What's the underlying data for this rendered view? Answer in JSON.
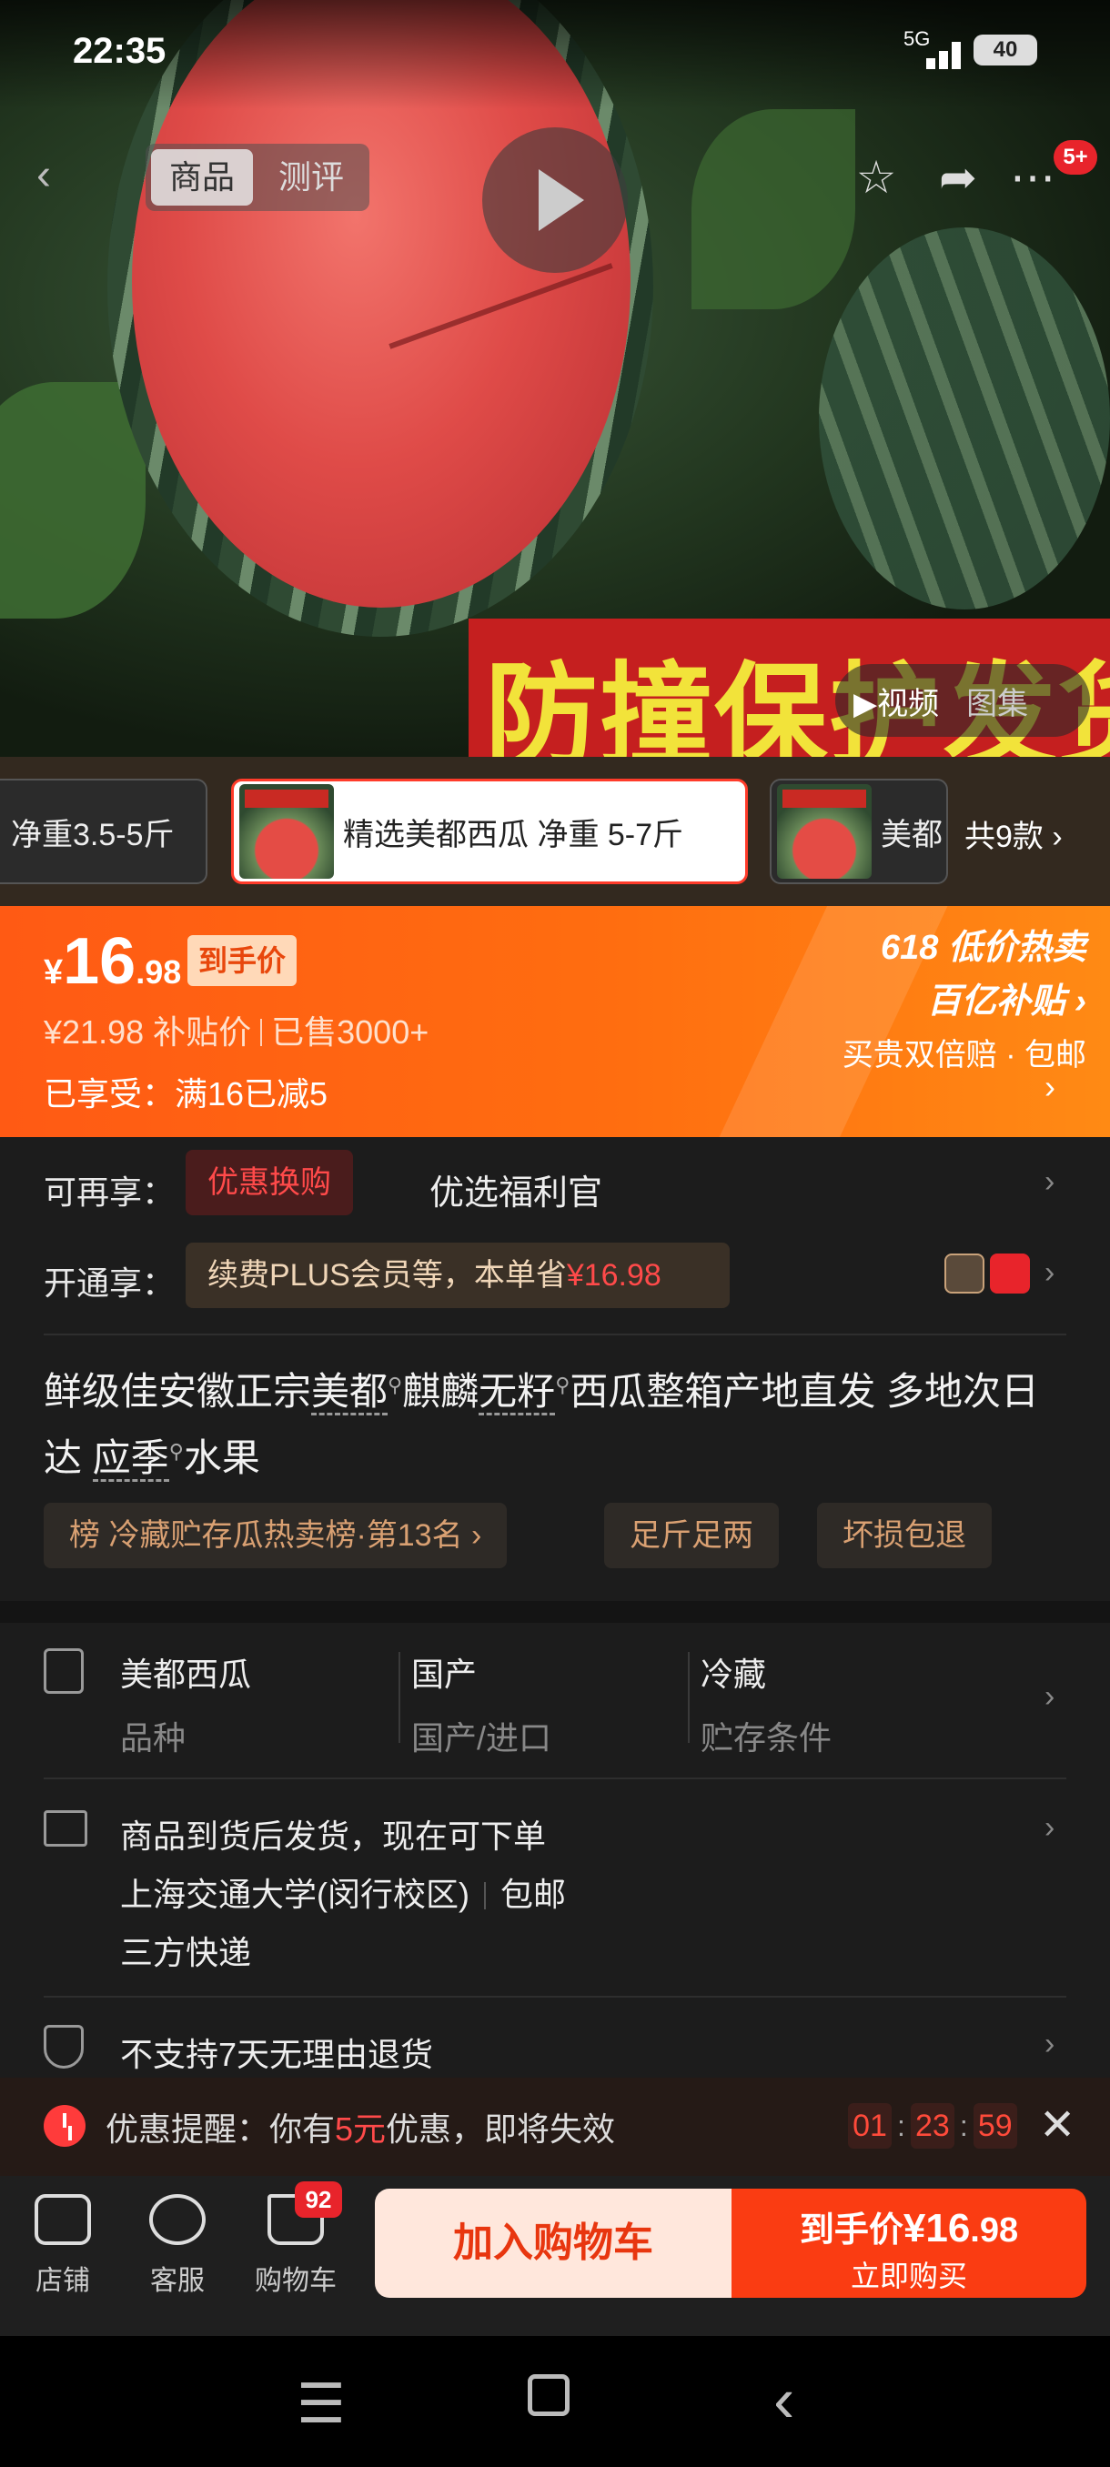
{
  "status_bar": {
    "time": "22:35",
    "network": "5G",
    "battery": "40"
  },
  "top_nav": {
    "tabs": [
      {
        "label": "商品",
        "active": true
      },
      {
        "label": "测评",
        "active": false
      }
    ],
    "badge": "5+",
    "icons": [
      "back-icon",
      "star-icon",
      "share-icon",
      "more-icon",
      "play-icon"
    ]
  },
  "hero": {
    "banner_text": "防撞保护发货",
    "media_tabs": [
      {
        "label": "▶视频",
        "active": true
      },
      {
        "label": "图集",
        "active": false
      }
    ]
  },
  "variants": {
    "items": [
      {
        "label": "净重3.5-5斤",
        "selected": false
      },
      {
        "label": "精选美都西瓜 净重 5-7斤",
        "selected": true
      },
      {
        "label": "美都",
        "selected": false
      }
    ],
    "count_label": "共9款 ›"
  },
  "price": {
    "currency": "¥",
    "integer": "16",
    "decimal": ".98",
    "tag": "到手价",
    "original": "¥21.98",
    "subsidy_label": "补贴价",
    "sold": "已售3000+",
    "discount": "已享受：满16已减5",
    "promo_line1": "618 低价热卖",
    "promo_line2": "百亿补贴 ›",
    "promo_line3": "买贵双倍赔 · 包邮",
    "accent_color": "#ff5a14"
  },
  "coupons": {
    "row1_label": "可再享：",
    "row1_pill": "优惠换购",
    "row1_text": "优选福利官",
    "row2_label": "开通享：",
    "row2_pill_text": "续费PLUS会员等，本单省",
    "row2_pill_amount": "¥16.98"
  },
  "product_title": {
    "part1": "鲜级佳安徽正宗",
    "kw1": "美都",
    "part2": "麒麟",
    "kw2": "无籽",
    "part3": "西瓜整箱产地直发 多地次日达 ",
    "kw3": "应季",
    "part4": "水果"
  },
  "tags": [
    "榜 冷藏贮存瓜热卖榜·第13名 ›",
    "足斤足两",
    "坏损包退"
  ],
  "attributes": [
    {
      "value": "美都西瓜",
      "key": "品种"
    },
    {
      "value": "国产",
      "key": "国产/进口"
    },
    {
      "value": "冷藏",
      "key": "贮存条件"
    }
  ],
  "shipping": {
    "line1": "商品到货后发货，现在可下单",
    "location": "上海交通大学(闵行校区)",
    "free_shipping": "包邮",
    "carrier": "三方快递"
  },
  "returns": "不支持7天无理由退货",
  "reminder": {
    "prefix": "优惠提醒：你有",
    "amount": "5元",
    "suffix": "优惠，即将失效",
    "timer": [
      "01",
      "23",
      "59"
    ]
  },
  "bottom_bar": {
    "store": "店铺",
    "service": "客服",
    "cart": "购物车",
    "cart_badge": "92",
    "add_to_cart": "加入购物车",
    "buy_prefix": "到手价",
    "buy_price": "¥16",
    "buy_decimal": ".98",
    "buy_now": "立即购买"
  }
}
